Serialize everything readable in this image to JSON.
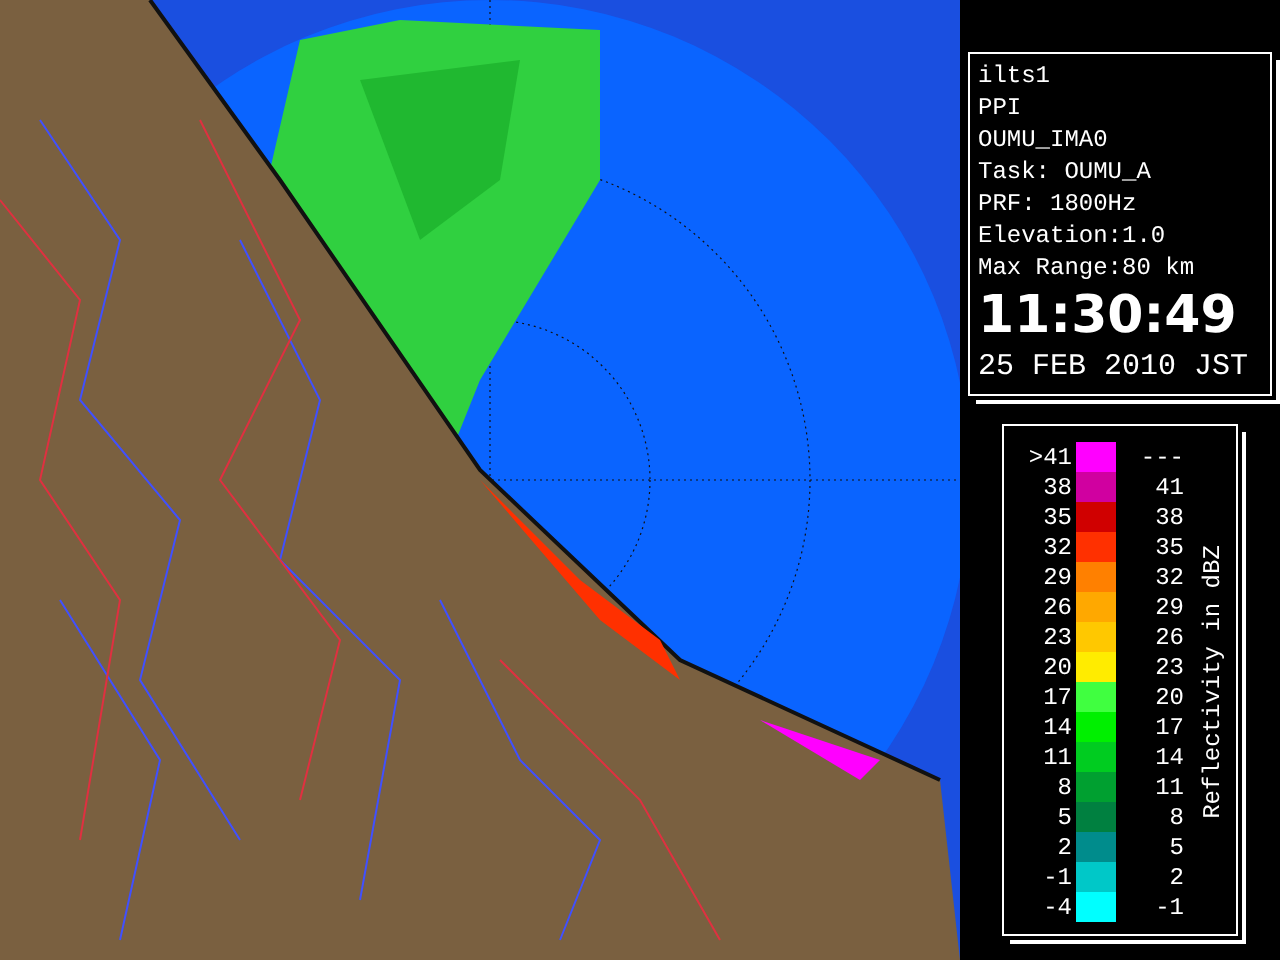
{
  "info": {
    "lines": [
      "ilts1",
      "PPI",
      "OUMU_IMA0",
      "Task: OUMU_A",
      "PRF: 1800Hz",
      "Elevation:1.0",
      "Max Range:80 km"
    ],
    "time": "11:30:49",
    "date": "25 FEB 2010 JST"
  },
  "legend": {
    "title": "Reflectivity in dBZ",
    "rows": [
      {
        "low": ">41",
        "high": "---",
        "color": "#ff00ff"
      },
      {
        "low": "38",
        "high": "41",
        "color": "#d000a0"
      },
      {
        "low": "35",
        "high": "38",
        "color": "#d00000"
      },
      {
        "low": "32",
        "high": "35",
        "color": "#ff3000"
      },
      {
        "low": "29",
        "high": "32",
        "color": "#ff8000"
      },
      {
        "low": "26",
        "high": "29",
        "color": "#ffa800"
      },
      {
        "low": "23",
        "high": "26",
        "color": "#ffc800"
      },
      {
        "low": "20",
        "high": "23",
        "color": "#ffec00"
      },
      {
        "low": "17",
        "high": "20",
        "color": "#40ff40"
      },
      {
        "low": "14",
        "high": "17",
        "color": "#00f000"
      },
      {
        "low": "11",
        "high": "14",
        "color": "#00cc20"
      },
      {
        "low": "8",
        "high": "11",
        "color": "#00a030"
      },
      {
        "low": "5",
        "high": "8",
        "color": "#008040"
      },
      {
        "low": "2",
        "high": "5",
        "color": "#008c8c"
      },
      {
        "low": "-1",
        "high": "2",
        "color": "#00c8c8"
      },
      {
        "low": "-4",
        "high": "-1",
        "color": "#00ffff"
      }
    ]
  }
}
